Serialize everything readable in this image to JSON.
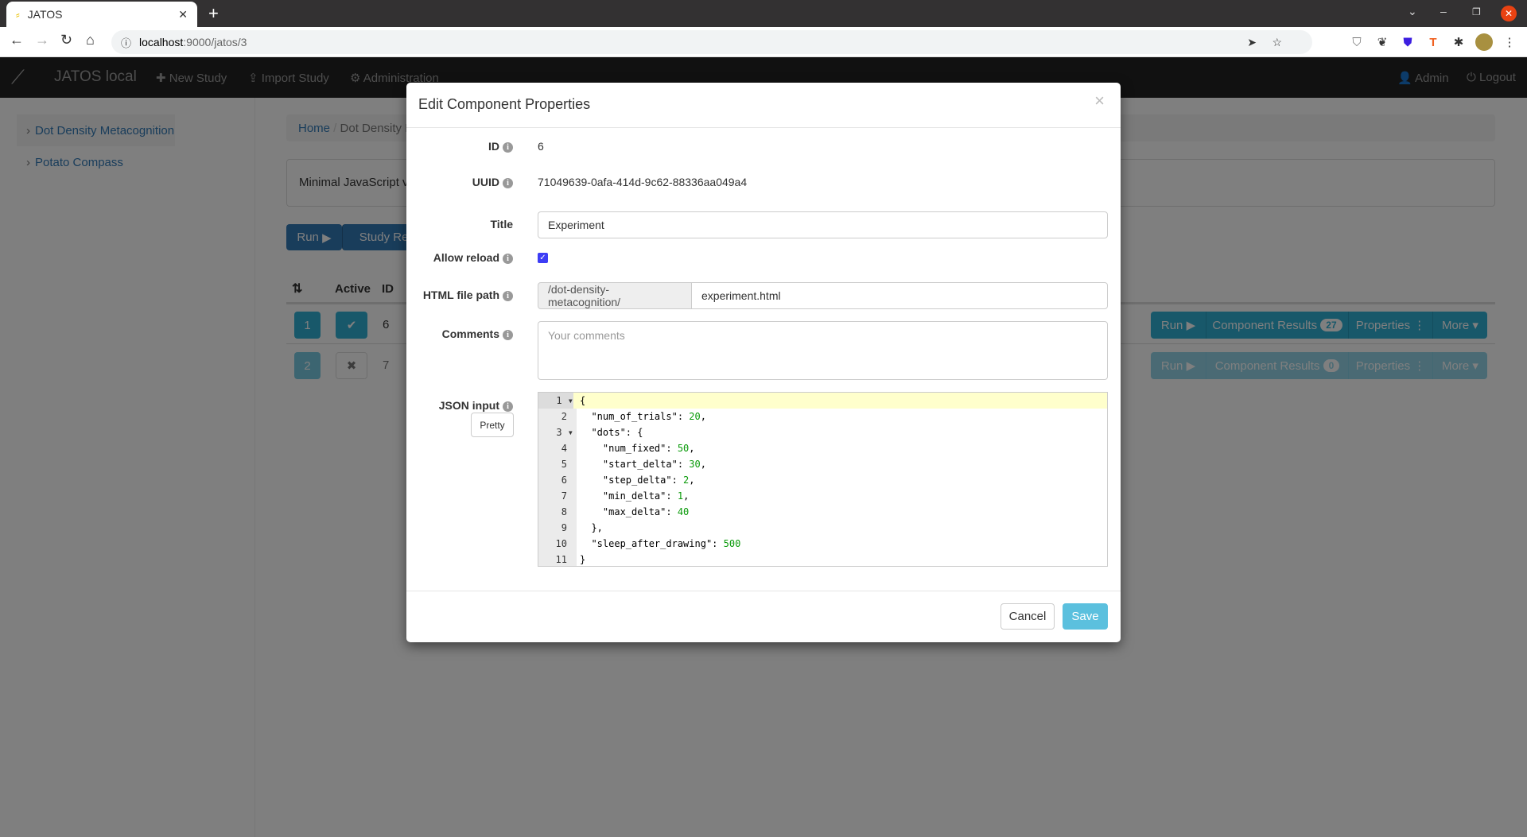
{
  "browser": {
    "tab_title": "JATOS",
    "url_host": "localhost",
    "url_path": ":9000/jatos/3"
  },
  "navbar": {
    "brand": "JATOS local",
    "new_study": "New Study",
    "import_study": "Import Study",
    "administration": "Administration",
    "admin": "Admin",
    "logout": "Logout"
  },
  "sidebar": {
    "items": [
      {
        "label": "Dot Density Metacognition"
      },
      {
        "label": "Potato Compass"
      }
    ]
  },
  "main": {
    "breadcrumb_home": "Home",
    "breadcrumb_current": "Dot Density M",
    "description": "Minimal JavaScript ve",
    "run_label": "Run",
    "study_results_label": "Study Resu",
    "table_headers": {
      "active": "Active",
      "id": "ID"
    },
    "rows": [
      {
        "position": "1",
        "id": "6",
        "active": true,
        "run": "Run",
        "results": "Component Results",
        "results_count": "27",
        "properties": "Properties",
        "more": "More"
      },
      {
        "position": "2",
        "id": "7",
        "active": false,
        "run": "Run",
        "results": "Component Results",
        "results_count": "0",
        "properties": "Properties",
        "more": "More"
      }
    ]
  },
  "modal": {
    "title": "Edit Component Properties",
    "close": "×",
    "id_label": "ID",
    "id_value": "6",
    "uuid_label": "UUID",
    "uuid_value": "71049639-0afa-414d-9c62-88336aa049a4",
    "title_label": "Title",
    "title_value": "Experiment",
    "allow_reload_label": "Allow reload",
    "allow_reload": true,
    "html_path_label": "HTML file path",
    "html_path_prefix": "/dot-density-metacognition/",
    "html_path_value": "experiment.html",
    "comments_label": "Comments",
    "comments_placeholder": "Your comments",
    "json_label": "JSON input",
    "pretty_label": "Pretty",
    "json_lines": [
      [
        {
          "t": "{"
        }
      ],
      [
        {
          "t": "  \"num_of_trials\": "
        },
        {
          "t": "20",
          "n": 1
        },
        {
          "t": ","
        }
      ],
      [
        {
          "t": "  \"dots\": {"
        }
      ],
      [
        {
          "t": "    \"num_fixed\": "
        },
        {
          "t": "50",
          "n": 1
        },
        {
          "t": ","
        }
      ],
      [
        {
          "t": "    \"start_delta\": "
        },
        {
          "t": "30",
          "n": 1
        },
        {
          "t": ","
        }
      ],
      [
        {
          "t": "    \"step_delta\": "
        },
        {
          "t": "2",
          "n": 1
        },
        {
          "t": ","
        }
      ],
      [
        {
          "t": "    \"min_delta\": "
        },
        {
          "t": "1",
          "n": 1
        },
        {
          "t": ","
        }
      ],
      [
        {
          "t": "    \"max_delta\": "
        },
        {
          "t": "40",
          "n": 1
        }
      ],
      [
        {
          "t": "  },"
        }
      ],
      [
        {
          "t": "  \"sleep_after_drawing\": "
        },
        {
          "t": "500",
          "n": 1
        }
      ],
      [
        {
          "t": "}"
        }
      ]
    ],
    "cancel_label": "Cancel",
    "save_label": "Save"
  },
  "colors": {
    "primary": "#337ab7",
    "info": "#5bc0de",
    "save": "#5bc0de",
    "brand_bg": "#222222"
  }
}
